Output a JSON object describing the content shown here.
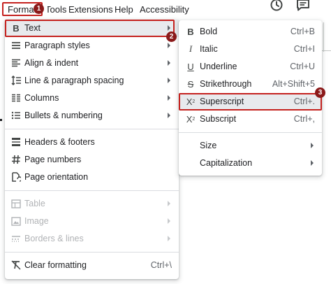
{
  "menubar": {
    "items": [
      {
        "label": "Format"
      },
      {
        "label": "Tools"
      },
      {
        "label": "Extensions"
      },
      {
        "label": "Help"
      },
      {
        "label": "Accessibility"
      }
    ],
    "icons": [
      "clock-icon",
      "comment-icon"
    ]
  },
  "format_menu": {
    "items": [
      {
        "label": "Text",
        "icon": "bold-b-icon",
        "submenu": true,
        "highlighted": true
      },
      {
        "label": "Paragraph styles",
        "icon": "paragraph-lines-icon",
        "submenu": true
      },
      {
        "label": "Align & indent",
        "icon": "align-icon",
        "submenu": true
      },
      {
        "label": "Line & paragraph spacing",
        "icon": "line-spacing-icon",
        "submenu": true
      },
      {
        "label": "Columns",
        "icon": "columns-icon",
        "submenu": true
      },
      {
        "label": "Bullets & numbering",
        "icon": "bullets-icon",
        "submenu": true
      },
      {
        "label": "Headers & footers",
        "icon": "headers-footers-icon"
      },
      {
        "label": "Page numbers",
        "icon": "hash-icon"
      },
      {
        "label": "Page orientation",
        "icon": "page-orientation-icon"
      },
      {
        "label": "Table",
        "icon": "table-icon",
        "submenu": true,
        "disabled": true
      },
      {
        "label": "Image",
        "icon": "image-icon",
        "submenu": true,
        "disabled": true
      },
      {
        "label": "Borders & lines",
        "icon": "borders-icon",
        "submenu": true,
        "disabled": true
      },
      {
        "label": "Clear formatting",
        "icon": "clear-formatting-icon",
        "shortcut": "Ctrl+\\"
      }
    ]
  },
  "text_submenu": {
    "items": [
      {
        "label": "Bold",
        "icon": "bold-icon",
        "shortcut": "Ctrl+B"
      },
      {
        "label": "Italic",
        "icon": "italic-icon",
        "shortcut": "Ctrl+I"
      },
      {
        "label": "Underline",
        "icon": "underline-icon",
        "shortcut": "Ctrl+U"
      },
      {
        "label": "Strikethrough",
        "icon": "strikethrough-icon",
        "shortcut": "Alt+Shift+5"
      },
      {
        "label": "Superscript",
        "icon": "superscript-icon",
        "shortcut": "Ctrl+.",
        "highlighted": true
      },
      {
        "label": "Subscript",
        "icon": "subscript-icon",
        "shortcut": "Ctrl+,"
      },
      {
        "label": "Size",
        "submenu": true
      },
      {
        "label": "Capitalization",
        "submenu": true
      }
    ]
  },
  "annotations": {
    "badges": [
      "1",
      "2",
      "3"
    ],
    "highlight_color": "#c5221f",
    "badge_color": "#8b1a1a"
  },
  "colors": {
    "menu_bg": "#ffffff",
    "highlight_bg": "#e8eaed",
    "text": "#202124",
    "shortcut_text": "#5f6368",
    "disabled_text": "#b1b3b6"
  }
}
